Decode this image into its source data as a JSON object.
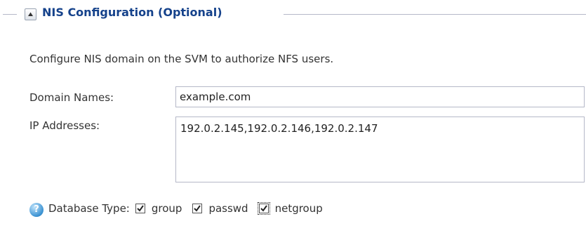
{
  "section": {
    "title": "NIS Configuration (Optional)",
    "toggle_icon": "collapse-up-arrow",
    "description": "Configure NIS domain on the SVM to authorize NFS users."
  },
  "form": {
    "domain_names": {
      "label": "Domain Names:",
      "value": "example.com"
    },
    "ip_addresses": {
      "label": "IP Addresses:",
      "value": "192.0.2.145,192.0.2.146,192.0.2.147"
    },
    "database_type": {
      "help_icon": "?",
      "label": "Database Type:",
      "options": [
        {
          "label": "group",
          "checked": true
        },
        {
          "label": "passwd",
          "checked": true
        },
        {
          "label": "netgroup",
          "checked": true
        }
      ]
    }
  },
  "colors": {
    "title": "#15428b",
    "border": "#b5b8c8",
    "text": "#333333"
  }
}
